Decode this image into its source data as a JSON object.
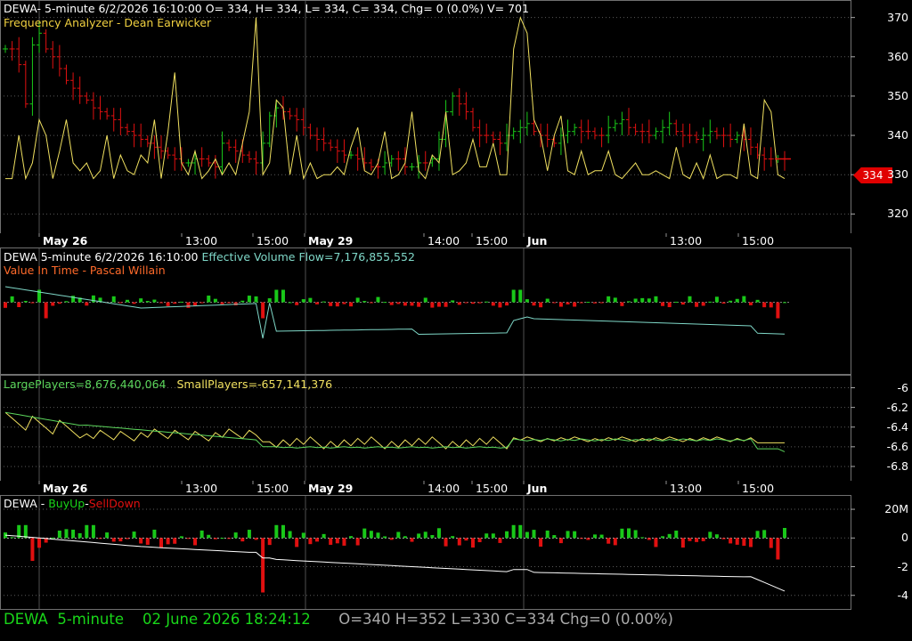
{
  "colors": {
    "background": "#000000",
    "grid": "#5a5a5a",
    "up_bar": "#19c819",
    "down_bar": "#e01010",
    "yellow": "#f0e060",
    "evf": "#7fd8c8",
    "largeplayers": "#5cd65c",
    "white": "#ffffff",
    "orange": "#ff6a2a"
  },
  "panel1": {
    "header": "DEWA- 5-minute 6/2/2026 16:10:00 O= 334, H= 334, L= 334, C= 334, Chg= 0 (0.0%) V= 701",
    "indicator": "Frequency Analyzer - Dean Earwicker",
    "price_tag": "334"
  },
  "panel2": {
    "header": "DEWA 5-minute  6/2/2026 16:10:00",
    "evf_label": "Effective Volume Flow=7,176,855,552",
    "indicator": "Value In Time - Pascal Willain"
  },
  "panel3": {
    "large_label": "LargePlayers=8,676,440,064",
    "small_label": "SmallPlayers=-657,141,376"
  },
  "panel4": {
    "symbol": "DEWA",
    "sep1": " - ",
    "buyup": "BuyUp",
    "sep2": "-",
    "selldown": "SellDown"
  },
  "status_bar": {
    "symbol": "DEWA",
    "interval": "5-minute",
    "datetime": "02 June 2026 18:24:12",
    "ohlc": "O=340  H=352  L=330  C=334  Chg=0 (0.00%)"
  },
  "chart_data": [
    {
      "type": "line",
      "subtype": "ohlc-bars",
      "panel": "price",
      "title": "DEWA- 5-minute 6/2/2026 16:10:00 O= 334, H= 334, L= 334, C= 334, Chg= 0 (0.0%) V= 701",
      "ylim": [
        316,
        374
      ],
      "y_ticks": [
        320,
        330,
        340,
        350,
        360,
        370
      ],
      "x_ticks": [
        "May 26",
        "13:00",
        "15:00",
        "May 29",
        "14:00",
        "15:00",
        "Jun",
        "13:00",
        "15:00"
      ],
      "series": [
        {
          "name": "Frequency Analyzer - Dean Earwicker",
          "color": "#f0e060",
          "values": [
            329,
            329,
            340,
            329,
            333,
            344,
            340,
            329,
            336,
            344,
            333,
            331,
            333,
            329,
            331,
            340,
            329,
            335,
            331,
            330,
            335,
            333,
            344,
            329,
            341,
            356,
            333,
            330,
            336,
            329,
            331,
            334,
            330,
            333,
            330,
            338,
            346,
            370,
            330,
            333,
            349,
            347,
            330,
            340,
            329,
            333,
            329,
            330,
            330,
            332,
            330,
            337,
            342,
            331,
            330,
            333,
            341,
            329,
            330,
            333,
            346,
            331,
            329,
            335,
            333,
            346,
            330,
            331,
            333,
            339,
            332,
            332,
            338,
            330,
            330,
            362,
            370,
            366,
            344,
            340,
            331,
            340,
            345,
            331,
            330,
            336,
            330,
            331,
            331,
            336,
            330,
            329,
            331,
            333,
            330,
            330,
            331,
            330,
            329,
            337,
            330,
            329,
            333,
            329,
            335,
            329,
            330,
            330,
            329,
            343,
            330,
            329,
            349,
            346,
            330,
            329
          ]
        },
        {
          "name": "Close",
          "color": "#e01010",
          "values": [
            362,
            362,
            358,
            348,
            363,
            366,
            362,
            360,
            357,
            354,
            352,
            350,
            349,
            347,
            346,
            345,
            344,
            342,
            341,
            340,
            339,
            338,
            337,
            336,
            335,
            334,
            333,
            333,
            334,
            334,
            333,
            332,
            338,
            337,
            336,
            335,
            334,
            333,
            338,
            345,
            347,
            346,
            345,
            344,
            342,
            340,
            339,
            338,
            337,
            336,
            335,
            335,
            334,
            333,
            332,
            332,
            333,
            334,
            334,
            332,
            332,
            333,
            333,
            334,
            339,
            346,
            350,
            348,
            346,
            342,
            340,
            340,
            339,
            338,
            340,
            341,
            342,
            343,
            341,
            340,
            339,
            338,
            340,
            341,
            342,
            341,
            341,
            340,
            340,
            342,
            343,
            344,
            342,
            341,
            341,
            340,
            341,
            342,
            343,
            341,
            340,
            340,
            339,
            340,
            341,
            340,
            340,
            339,
            340,
            339,
            337,
            335,
            334,
            334,
            334,
            334
          ]
        }
      ]
    },
    {
      "type": "line",
      "panel": "value-in-time",
      "title": "DEWA 5-minute  6/2/2026 16:10:00",
      "series": [
        {
          "name": "Effective Volume Flow=7,176,855,552",
          "color": "#7fd8c8"
        }
      ]
    },
    {
      "type": "line",
      "panel": "players",
      "ylim": [
        -6.9,
        -5.95
      ],
      "y_ticks": [
        -6,
        -6.2,
        -6.4,
        -6.6,
        -6.8
      ],
      "series": [
        {
          "name": "LargePlayers=8,676,440,064",
          "color": "#5cd65c"
        },
        {
          "name": "SmallPlayers=-657,141,376",
          "color": "#f0e060"
        }
      ]
    },
    {
      "type": "bar",
      "panel": "buyup-selldown",
      "ylim": [
        -4.7,
        2.5
      ],
      "y_ticks": [
        2,
        0,
        -2,
        -4
      ],
      "y_tick_labels": [
        "20M",
        "0",
        "-2",
        "-4"
      ],
      "series": [
        {
          "name": "BuyUp",
          "color": "#19c819"
        },
        {
          "name": "SellDown",
          "color": "#e01010"
        }
      ]
    }
  ]
}
